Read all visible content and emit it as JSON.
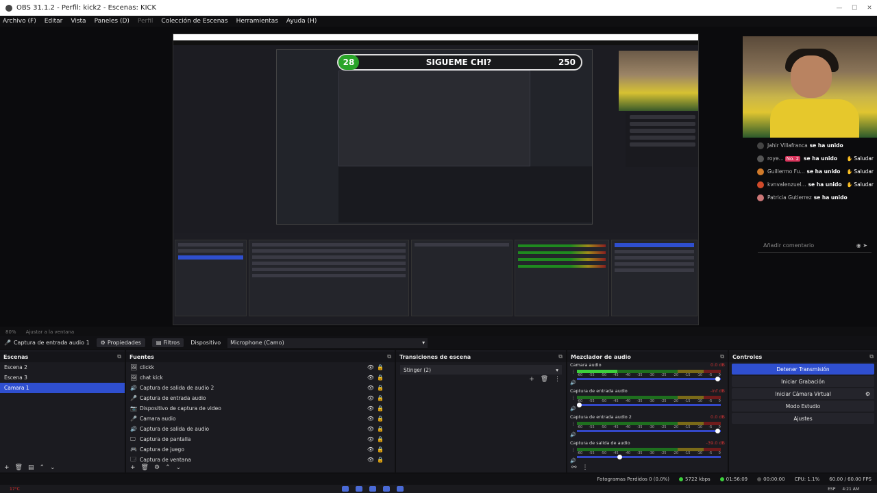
{
  "window": {
    "title": "OBS 31.1.2 - Perfil: kick2 - Escenas: KICK",
    "controls": [
      "—",
      "☐",
      "✕"
    ]
  },
  "menu": [
    "Archivo (F)",
    "Editar",
    "Vista",
    "Paneles (D)",
    "Perfil",
    "Colección de Escenas",
    "Herramientas",
    "Ayuda (H)"
  ],
  "preview": {
    "goal_left": "28",
    "goal_title": "SIGUEME CHI?",
    "goal_right": "250"
  },
  "chat": {
    "messages": [
      {
        "user": "Jahir Villafranca",
        "text": "se ha unido",
        "badge": "",
        "greet": "",
        "color": "#444"
      },
      {
        "user": "roye...",
        "text": "se ha unido",
        "badge": "No. 2",
        "greet": "Saludar",
        "color": "#555"
      },
      {
        "user": "Guillermo Fu...",
        "text": "se ha unido",
        "badge": "",
        "greet": "Saludar",
        "color": "#d07a2a"
      },
      {
        "user": "kvnvalenzuel...",
        "text": "se ha unido",
        "badge": "",
        "greet": "Saludar",
        "color": "#d04a2a"
      },
      {
        "user": "Patricia Gutierrez",
        "text": "se ha unido",
        "badge": "",
        "greet": "",
        "color": "#c77"
      }
    ],
    "placeholder": "Añadir comentario"
  },
  "zoom": {
    "level": "80%",
    "fit": "Ajustar a la ventana"
  },
  "source_toolbar": {
    "source_name": "Captura de entrada audio 1",
    "properties": "Propiedades",
    "filters": "Filtros",
    "device_label": "Dispositivo",
    "device_value": "Microphone (Camo)"
  },
  "scenes": {
    "title": "Escenas",
    "items": [
      "Escena 2",
      "Escena 3",
      "Camara 1"
    ],
    "selected": 2
  },
  "sources": {
    "title": "Fuentes",
    "items": [
      {
        "icon": "🖼",
        "name": "clickk"
      },
      {
        "icon": "🖼",
        "name": "chat kick"
      },
      {
        "icon": "🔊",
        "name": "Captura de salida de audio 2"
      },
      {
        "icon": "🎤",
        "name": "Captura de entrada audio"
      },
      {
        "icon": "📷",
        "name": "Dispositivo de captura de video"
      },
      {
        "icon": "🎤",
        "name": "Camara audio"
      },
      {
        "icon": "🔊",
        "name": "Captura de salida de audio"
      },
      {
        "icon": "🖵",
        "name": "Captura de pantalla"
      },
      {
        "icon": "🎮",
        "name": "Captura de juego"
      },
      {
        "icon": "🗔",
        "name": "Captura de ventana"
      }
    ]
  },
  "transitions": {
    "title": "Transiciones de escena",
    "selected": "Stinger (2)"
  },
  "mixer": {
    "title": "Mezclador de audio",
    "channels": [
      {
        "name": "Camara audio",
        "db": "0.0 dB",
        "level": 0.28,
        "fader": 0.98
      },
      {
        "name": "Captura de entrada audio",
        "db": "-inf dB",
        "level": 0.0,
        "fader": 0.02
      },
      {
        "name": "Captura de entrada audio 2",
        "db": "0.0 dB",
        "level": 0.0,
        "fader": 0.98
      },
      {
        "name": "Captura de salida de audio",
        "db": "-39.0 dB",
        "level": 0.0,
        "fader": 0.3
      }
    ],
    "scale": [
      "-60",
      "-55",
      "-50",
      "-45",
      "-40",
      "-35",
      "-30",
      "-25",
      "-20",
      "-15",
      "-10",
      "-5",
      "0"
    ]
  },
  "controls": {
    "title": "Controles",
    "buttons": [
      "Detener Transmisión",
      "Iniciar Grabación",
      "Iniciar Cámara Virtual",
      "Modo Estudio",
      "Ajustes"
    ]
  },
  "status": {
    "dropped": "Fotogramas Perdidos 0 (0.0%)",
    "bitrate": "5722 kbps",
    "live_time": "01:56:09",
    "rec_time": "00:00:00",
    "cpu": "CPU: 1.1%",
    "fps": "60.00 / 60.00 FPS"
  },
  "taskbar": {
    "weather": "17°C",
    "lang": "ESP",
    "clock": "4:21 AM"
  },
  "colors": {
    "accent": "#2f4fcf",
    "meter_green": "#3ccf3c",
    "meter_red": "#c33333"
  }
}
